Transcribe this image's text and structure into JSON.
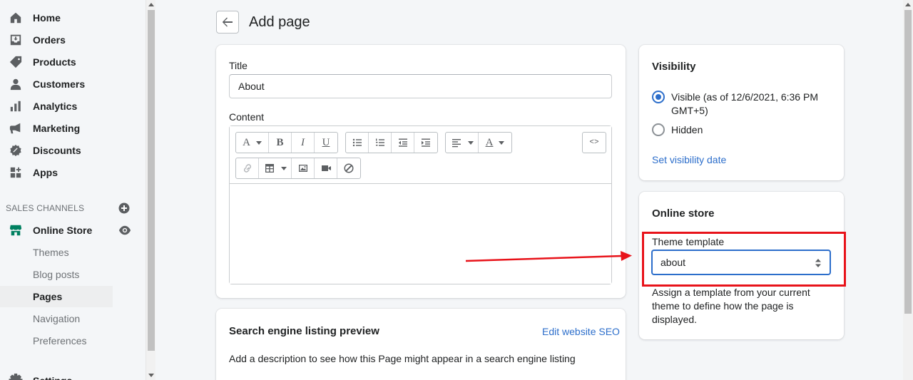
{
  "sidebar": {
    "items": [
      {
        "label": "Home",
        "icon": "home-icon"
      },
      {
        "label": "Orders",
        "icon": "orders-icon"
      },
      {
        "label": "Products",
        "icon": "tag-icon"
      },
      {
        "label": "Customers",
        "icon": "person-icon"
      },
      {
        "label": "Analytics",
        "icon": "bar-chart-icon"
      },
      {
        "label": "Marketing",
        "icon": "megaphone-icon"
      },
      {
        "label": "Discounts",
        "icon": "discount-icon"
      },
      {
        "label": "Apps",
        "icon": "apps-icon"
      }
    ],
    "sales_channels_label": "SALES CHANNELS",
    "online_store": {
      "label": "Online Store",
      "sub_items": [
        "Themes",
        "Blog posts",
        "Pages",
        "Navigation",
        "Preferences"
      ],
      "active_sub_item": "Pages"
    },
    "settings_label": "Settings"
  },
  "header": {
    "title": "Add page"
  },
  "page_form": {
    "title_label": "Title",
    "title_value": "About",
    "content_label": "Content"
  },
  "seo": {
    "heading": "Search engine listing preview",
    "edit_link": "Edit website SEO",
    "description": "Add a description to see how this Page might appear in a search engine listing"
  },
  "visibility": {
    "heading": "Visibility",
    "visible_option": "Visible (as of 12/6/2021, 6:36 PM GMT+5)",
    "hidden_option": "Hidden",
    "selected": "visible",
    "set_date_link": "Set visibility date"
  },
  "online_store_card": {
    "heading": "Online store",
    "theme_template_label": "Theme template",
    "theme_template_value": "about",
    "help_text": "Assign a template from your current theme to define how the page is displayed."
  },
  "colors": {
    "accent": "#2c6ecb",
    "annotation": "#e8131a"
  }
}
